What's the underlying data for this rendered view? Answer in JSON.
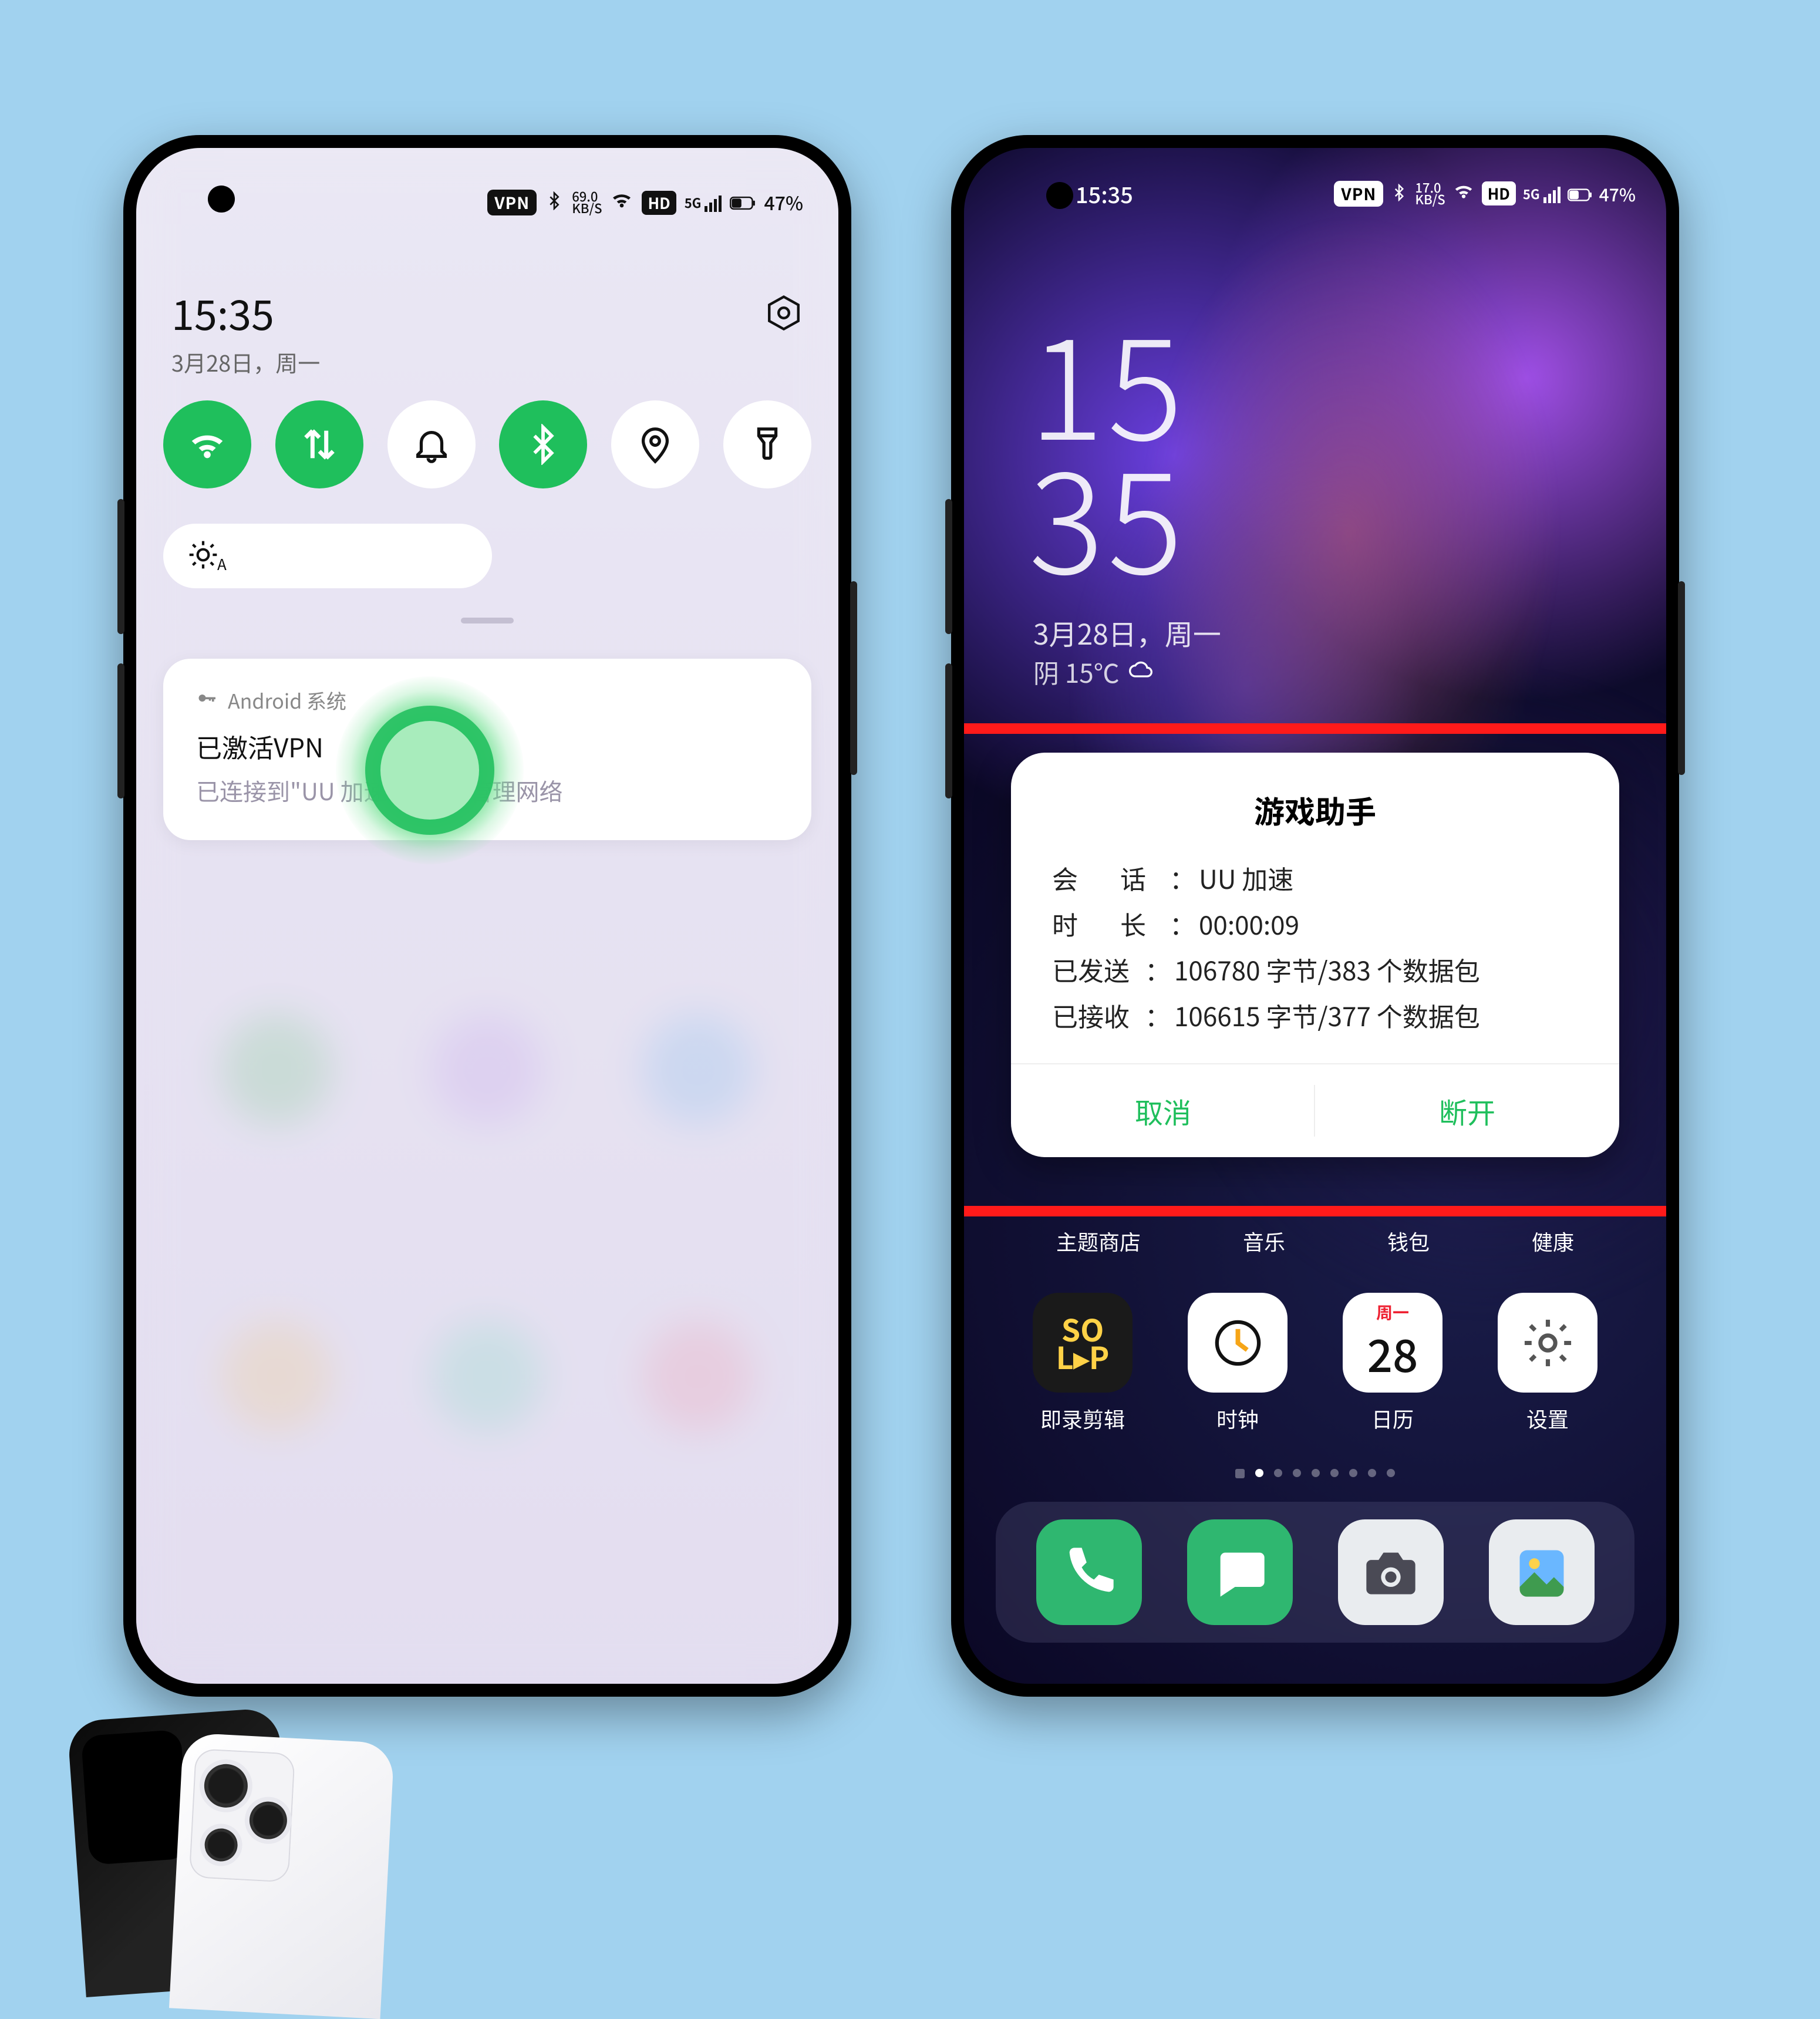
{
  "left": {
    "status": {
      "vpn": "VPN",
      "bt": "bt",
      "speed_top": "69.0",
      "speed_bot": "KB/S",
      "hd": "HD",
      "net": "5G",
      "battery": "47%",
      "wifi": "wifi"
    },
    "clock": "15:35",
    "date": "3月28日，周一",
    "qs": {
      "wifi": "wifi",
      "data": "data",
      "dnd": "dnd",
      "bt": "bt",
      "loc": "loc",
      "torch": "torch"
    },
    "brightness_mode": "A",
    "notif": {
      "source": "Android 系统",
      "title": "已激活VPN",
      "body": "已连接到\"UU 加速\"，点击管理网络"
    }
  },
  "right": {
    "status": {
      "time": "15:35",
      "vpn": "VPN",
      "speed_top": "17.0",
      "speed_bot": "KB/S",
      "hd": "HD",
      "net": "5G",
      "battery": "47%"
    },
    "lock": {
      "h": "15",
      "m": "35",
      "date": "3月28日，周一",
      "weather": "阴 15℃"
    },
    "dialog": {
      "title": "游戏助手",
      "rows": [
        {
          "k": "会　话",
          "v": "UU 加速"
        },
        {
          "k": "时　长",
          "v": "00:00:09"
        },
        {
          "k": "已发送",
          "v": "106780 字节/383 个数据包"
        },
        {
          "k": "已接收",
          "v": "106615 字节/377 个数据包"
        }
      ],
      "cancel": "取消",
      "disconnect": "断开"
    },
    "row_labels": [
      "主题商店",
      "音乐",
      "钱包",
      "健康"
    ],
    "apps": [
      {
        "name": "即录剪辑",
        "icon": "soloop",
        "line1": "SO",
        "line2": "L▸P"
      },
      {
        "name": "时钟",
        "icon": "clock"
      },
      {
        "name": "日历",
        "icon": "cal",
        "dow": "周一",
        "num": "28"
      },
      {
        "name": "设置",
        "icon": "settings"
      }
    ],
    "dock": [
      "phone",
      "msg",
      "camera",
      "photos"
    ]
  }
}
